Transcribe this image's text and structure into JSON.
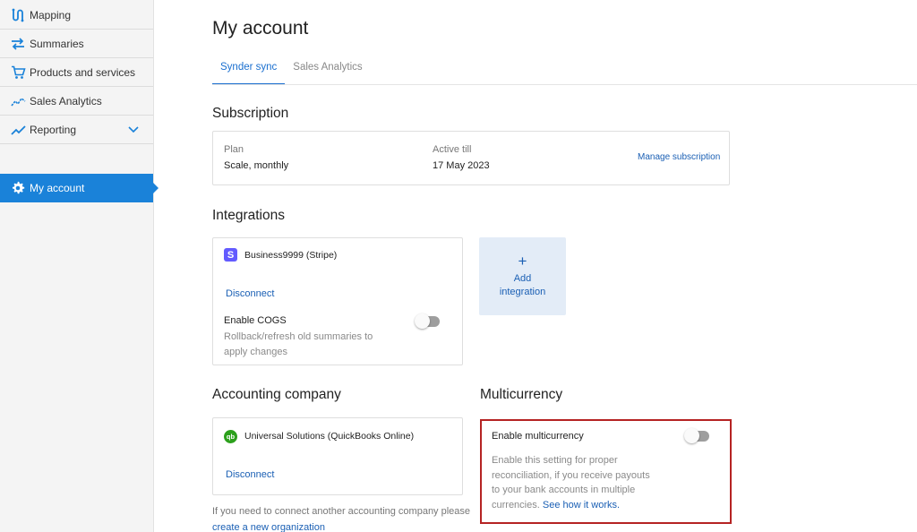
{
  "sidebar": {
    "items": [
      {
        "label": "Mapping",
        "icon": "mapping-icon"
      },
      {
        "label": "Summaries",
        "icon": "arrows-icon"
      },
      {
        "label": "Products and services",
        "icon": "cart-icon"
      },
      {
        "label": "Sales Analytics",
        "icon": "analytics-icon"
      },
      {
        "label": "Reporting",
        "icon": "trend-icon"
      }
    ],
    "active_item": {
      "label": "My account",
      "icon": "gear-icon"
    }
  },
  "page": {
    "title": "My account"
  },
  "tabs": [
    {
      "label": "Synder sync",
      "active": true
    },
    {
      "label": "Sales Analytics",
      "active": false
    }
  ],
  "subscription": {
    "title": "Subscription",
    "plan_label": "Plan",
    "plan_value": "Scale, monthly",
    "active_label": "Active till",
    "active_value": "17 May 2023",
    "manage_link": "Manage subscription"
  },
  "integrations": {
    "title": "Integrations",
    "name": "Business9999 (Stripe)",
    "disconnect": "Disconnect",
    "cogs_title": "Enable COGS",
    "cogs_desc": "Rollback/refresh old summaries to apply changes",
    "cogs_enabled": false,
    "add_plus": "+",
    "add_label": "Add integration"
  },
  "accounting": {
    "title": "Accounting company",
    "name": "Universal Solutions (QuickBooks Online)",
    "disconnect": "Disconnect",
    "footer_text": "If you need to connect another accounting company please",
    "footer_link": "create a new organization"
  },
  "multicurrency": {
    "title": "Multicurrency",
    "toggle_label": "Enable multicurrency",
    "enabled": false,
    "desc": "Enable this setting for proper reconciliation, if you receive payouts to your bank accounts in multiple currencies.",
    "desc_link": "See how it works."
  },
  "colors": {
    "accent": "#1a82d9",
    "link": "#1a5fb4",
    "highlight_border": "#b52323",
    "stripe": "#635bff",
    "quickbooks": "#2ca01c"
  }
}
